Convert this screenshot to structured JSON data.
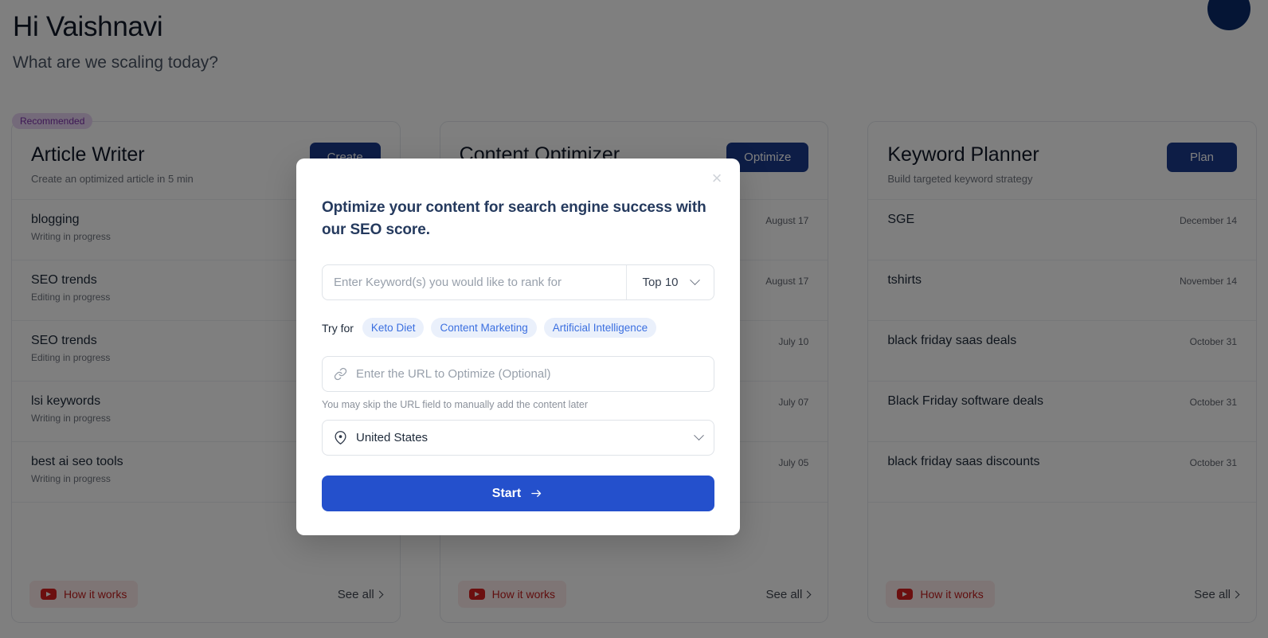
{
  "page": {
    "greeting_title": "Hi Vaishnavi",
    "greeting_subtitle": "What are we scaling today?",
    "avatar_label": "user-avatar"
  },
  "cards": [
    {
      "badge": "Recommended",
      "title": "Article Writer",
      "subtitle": "Create an optimized article in 5 min",
      "cta": "Create",
      "rows": [
        {
          "title": "blogging",
          "status": "Writing in progress",
          "date": ""
        },
        {
          "title": "SEO trends",
          "status": "Editing in progress",
          "date": ""
        },
        {
          "title": "SEO trends",
          "status": "Editing in progress",
          "date": ""
        },
        {
          "title": "lsi keywords",
          "status": "Writing in progress",
          "date": ""
        },
        {
          "title": "best ai seo tools",
          "status": "Writing in progress",
          "date": ""
        }
      ],
      "how_it_works": "How it works",
      "see_all": "See all"
    },
    {
      "badge": "",
      "title": "Content Optimizer",
      "subtitle": "",
      "cta": "Optimize",
      "rows": [
        {
          "title": "",
          "status": "",
          "date": "August 17"
        },
        {
          "title": "",
          "status": "",
          "date": "August 17"
        },
        {
          "title": "",
          "status": "",
          "date": "July 10"
        },
        {
          "title": "",
          "status": "",
          "date": "July 07"
        },
        {
          "title": "",
          "status": "",
          "date": "July 05"
        }
      ],
      "how_it_works": "How it works",
      "see_all": "See all"
    },
    {
      "badge": "",
      "title": "Keyword Planner",
      "subtitle": "Build targeted keyword strategy",
      "cta": "Plan",
      "rows": [
        {
          "title": "SGE",
          "status": "",
          "date": "December 14"
        },
        {
          "title": "tshirts",
          "status": "",
          "date": "November 14"
        },
        {
          "title": "black friday saas deals",
          "status": "",
          "date": "October 31"
        },
        {
          "title": "Black Friday software deals",
          "status": "",
          "date": "October 31"
        },
        {
          "title": "black friday saas discounts",
          "status": "",
          "date": "October 31"
        }
      ],
      "how_it_works": "How it works",
      "see_all": "See all"
    }
  ],
  "modal": {
    "close_label": "×",
    "heading": "Optimize your content for search engine success with our SEO score.",
    "keyword_placeholder": "Enter Keyword(s) you would like to rank for",
    "keyword_value": "",
    "rank_select_value": "Top 10",
    "try_for_label": "Try for",
    "chips": [
      "Keto Diet",
      "Content Marketing",
      "Artificial Intelligence"
    ],
    "url_placeholder": "Enter the URL to Optimize (Optional)",
    "url_value": "",
    "url_hint": "You may skip the URL field to manually add the content later",
    "location_value": "United States",
    "start_label": "Start"
  },
  "colors": {
    "primary_blue": "#2450cc",
    "card_cta_navy": "#1b3a8c",
    "chip_blue": "#3b6fe0",
    "badge_purple": "#7b2fa8",
    "youtube_red": "#c01c1c",
    "overlay": "rgba(0,0,0,0.5)"
  }
}
